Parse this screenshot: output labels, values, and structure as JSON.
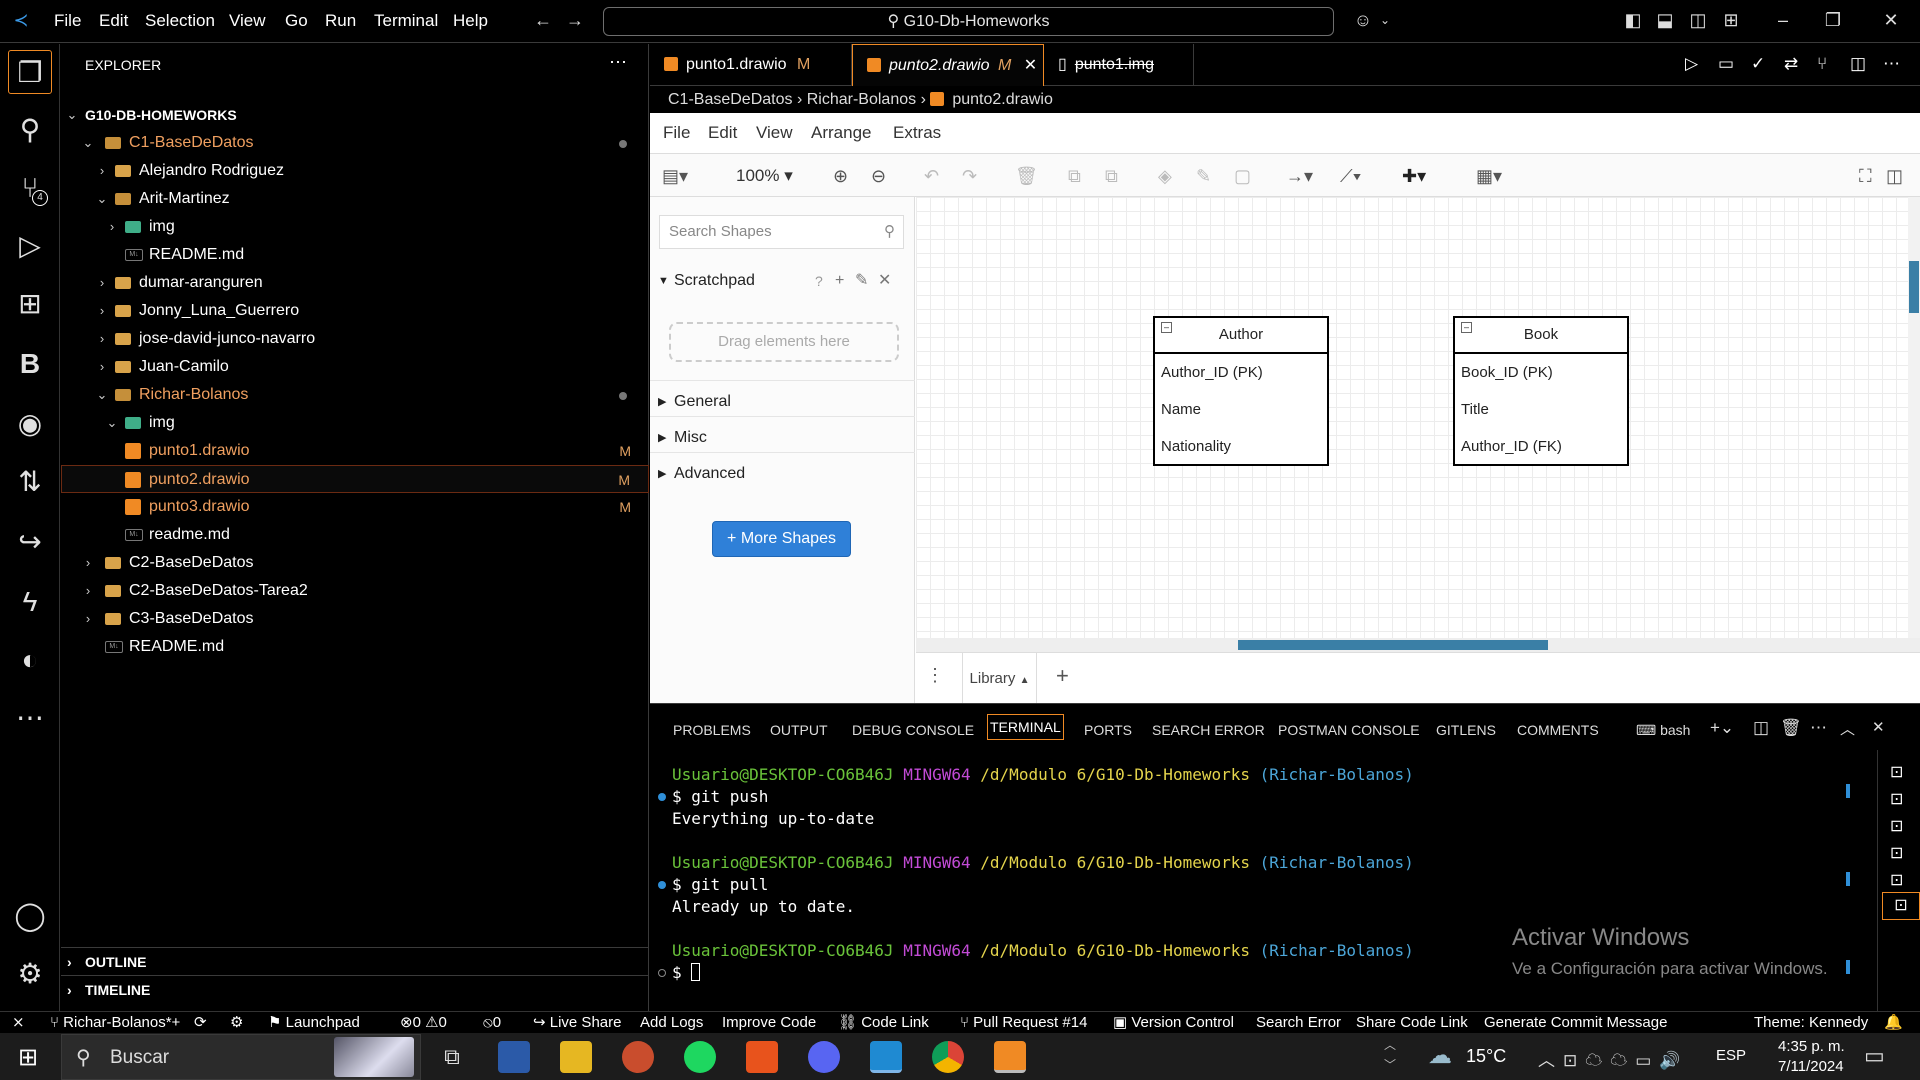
{
  "titlebar": {
    "menus": [
      "File",
      "Edit",
      "Selection",
      "View",
      "Go",
      "Run",
      "Terminal",
      "Help"
    ],
    "search": "G10-Db-Homeworks"
  },
  "explorer": {
    "title": "EXPLORER",
    "root": "G10-DB-HOMEWORKS",
    "rows": [
      {
        "label": "C1-BaseDeDatos"
      },
      {
        "label": "Alejandro Rodriguez"
      },
      {
        "label": "Arit-Martinez"
      },
      {
        "label": "img"
      },
      {
        "label": "README.md"
      },
      {
        "label": "dumar-aranguren"
      },
      {
        "label": "Jonny_Luna_Guerrero"
      },
      {
        "label": "jose-david-junco-navarro"
      },
      {
        "label": "Juan-Camilo"
      },
      {
        "label": "Richar-Bolanos"
      },
      {
        "label": "img"
      },
      {
        "label": "punto1.drawio",
        "flag": "M"
      },
      {
        "label": "punto2.drawio",
        "flag": "M"
      },
      {
        "label": "punto3.drawio",
        "flag": "M"
      },
      {
        "label": "readme.md"
      },
      {
        "label": "C2-BaseDeDatos"
      },
      {
        "label": "C2-BaseDeDatos-Tarea2"
      },
      {
        "label": "C3-BaseDeDatos"
      },
      {
        "label": "README.md"
      }
    ],
    "outline": "OUTLINE",
    "timeline": "TIMELINE"
  },
  "tabs": [
    {
      "label": "punto1.drawio",
      "flag": "M"
    },
    {
      "label": "punto2.drawio",
      "flag": "M"
    },
    {
      "label": "punto1.img"
    }
  ],
  "breadcrumb": {
    "a": "C1-BaseDeDatos",
    "b": "Richar-Bolanos",
    "c": "punto2.drawio"
  },
  "drawio": {
    "menus": [
      "File",
      "Edit",
      "View",
      "Arrange",
      "Extras"
    ],
    "zoom": "100%",
    "search_placeholder": "Search Shapes",
    "scratchpad": "Scratchpad",
    "dropzone": "Drag elements here",
    "sections": [
      "General",
      "Misc",
      "Advanced"
    ],
    "more_shapes": "More Shapes",
    "page_tab": "Library",
    "entities": [
      {
        "name": "Author",
        "fields": [
          "Author_ID (PK)",
          "Name",
          "Nationality"
        ]
      },
      {
        "name": "Book",
        "fields": [
          "Book_ID (PK)",
          "Title",
          "Author_ID (FK)"
        ]
      }
    ]
  },
  "panel": {
    "tabs": [
      "PROBLEMS",
      "OUTPUT",
      "DEBUG CONSOLE",
      "TERMINAL",
      "PORTS",
      "SEARCH ERROR",
      "POSTMAN CONSOLE",
      "GITLENS",
      "COMMENTS"
    ],
    "shell": "bash",
    "prompt_user": "Usuario@DESKTOP-CO6B46J",
    "prompt_env": "MINGW64",
    "prompt_path": "/d/Modulo 6/G10-Db-Homeworks",
    "prompt_branch": "(Richar-Bolanos)",
    "cmd1": "$ git push",
    "out1": "Everything up-to-date",
    "cmd2": "$ git pull",
    "out2": "Already up to date.",
    "cmd3": "$ "
  },
  "watermark": {
    "title": "Activar Windows",
    "subtitle": "Ve a Configuración para activar Windows."
  },
  "status": {
    "branch": "Richar-Bolanos*+",
    "launchpad": "Launchpad",
    "errors": "0",
    "warnings": "0",
    "ports": "0",
    "liveshare": "Live Share",
    "addlogs": "Add Logs",
    "improve": "Improve Code",
    "codelink": "Code Link",
    "pr": "Pull Request #14",
    "vc": "Version Control",
    "searcherror": "Search Error",
    "share": "Share Code Link",
    "commit": "Generate Commit Message",
    "theme": "Theme: Kennedy"
  },
  "taskbar": {
    "search": "Buscar",
    "temp": "15°C",
    "lang": "ESP",
    "time": "4:35 p. m.",
    "date": "7/11/2024"
  }
}
